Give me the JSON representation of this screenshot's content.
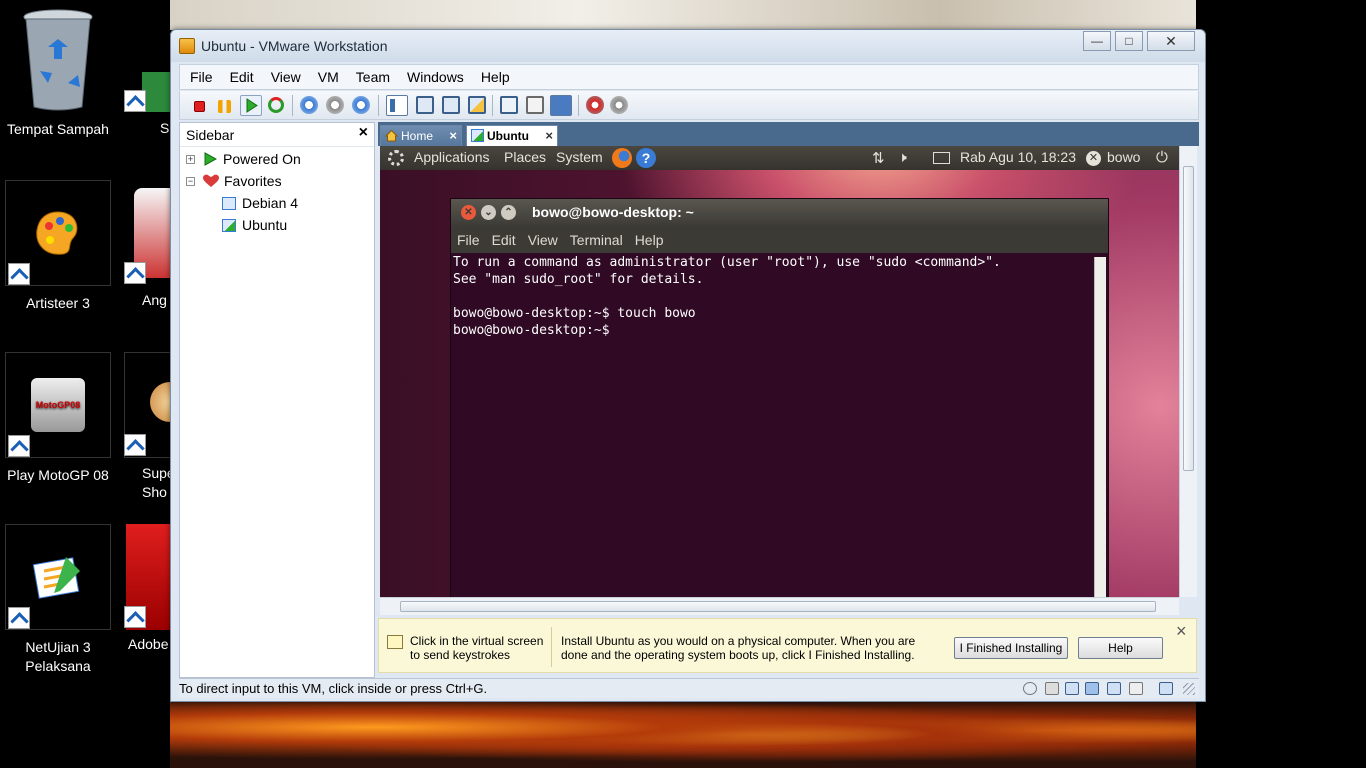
{
  "desktop": {
    "icons": [
      {
        "label": "Tempat Sampah"
      },
      {
        "label": "Artisteer 3"
      },
      {
        "label": "Play MotoGP 08"
      },
      {
        "label": "NetUjian 3 Pelaksana"
      }
    ],
    "partial_icons": [
      {
        "label": "S"
      },
      {
        "label": "Ang"
      },
      {
        "label": "Supe Sho"
      },
      {
        "label": "Adobe"
      }
    ],
    "partial_lines": [
      "Supe",
      "Sho"
    ]
  },
  "window": {
    "title": "Ubuntu - VMware Workstation",
    "menu": [
      "File",
      "Edit",
      "View",
      "VM",
      "Team",
      "Windows",
      "Help"
    ]
  },
  "sidebar": {
    "title": "Sidebar",
    "close": "×",
    "items": [
      {
        "label": "Powered On",
        "expander": "+"
      },
      {
        "label": "Favorites",
        "expander": "−"
      },
      {
        "label": "Debian 4"
      },
      {
        "label": "Ubuntu"
      }
    ]
  },
  "tabs": [
    {
      "label": "Home",
      "close": "×"
    },
    {
      "label": "Ubuntu",
      "close": "×"
    }
  ],
  "guest": {
    "panel": {
      "applications": "Applications",
      "places": "Places",
      "system": "System",
      "datetime": "Rab Agu 10, 18:23",
      "user": "bowo"
    },
    "terminal": {
      "title": "bowo@bowo-desktop: ~",
      "menu": [
        "File",
        "Edit",
        "View",
        "Terminal",
        "Help"
      ],
      "lines": [
        "To run a command as administrator (user \"root\"), use \"sudo <command>\".",
        "See \"man sudo_root\" for details.",
        "",
        "bowo@bowo-desktop:~$ touch bowo",
        "bowo@bowo-desktop:~$ "
      ]
    }
  },
  "hint": {
    "click_text_1": "Click in the virtual screen",
    "click_text_2": "to send keystrokes",
    "install_text_1": "Install Ubuntu as you would on a physical computer. When you are",
    "install_text_2": "done and the operating system boots up, click I Finished Installing.",
    "finished_button": "I Finished Installing",
    "help_button": "Help",
    "close": "×"
  },
  "status": {
    "message": "To direct input to this VM, click inside or press Ctrl+G."
  }
}
